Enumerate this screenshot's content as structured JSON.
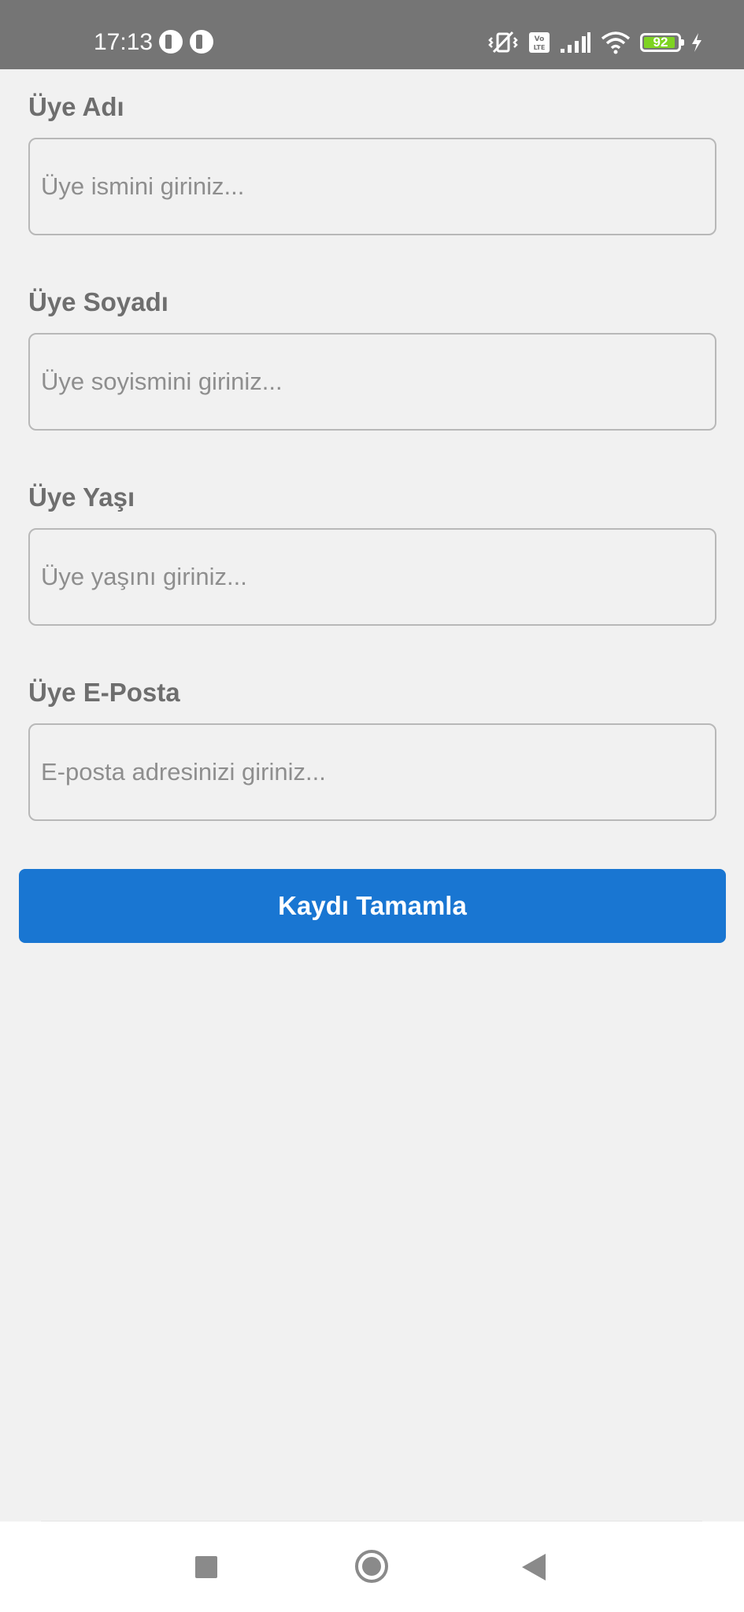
{
  "status_bar": {
    "time": "17:13",
    "battery_level": "92",
    "battery_fraction": 0.92,
    "icons": [
      "app-notification-icon",
      "app-notification-icon",
      "vibrate-off-icon",
      "volte-icon",
      "signal-icon",
      "wifi-icon",
      "battery-icon",
      "charging-icon"
    ]
  },
  "form": {
    "fields": [
      {
        "label": "Üye Adı",
        "placeholder": "Üye ismini giriniz...",
        "value": ""
      },
      {
        "label": "Üye Soyadı",
        "placeholder": "Üye soyismini giriniz...",
        "value": ""
      },
      {
        "label": "Üye Yaşı",
        "placeholder": "Üye yaşını giriniz...",
        "value": ""
      },
      {
        "label": "Üye E-Posta",
        "placeholder": "E-posta adresinizi giriniz...",
        "value": ""
      }
    ],
    "submit_label": "Kaydı Tamamla"
  },
  "nav_bar": {
    "buttons": [
      "recent-apps-button",
      "home-button",
      "back-button"
    ]
  },
  "colors": {
    "status_bar": "#757575",
    "background": "#f1f1f1",
    "accent": "#1976d2",
    "battery_fill": "#7ed321",
    "label_text": "#6e6e6e",
    "placeholder_text": "#8e8e8e"
  }
}
